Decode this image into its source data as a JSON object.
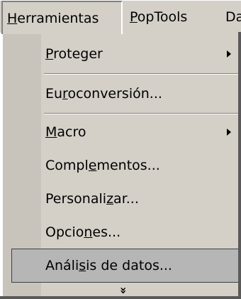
{
  "menubar": {
    "items": [
      {
        "pre": "",
        "key": "H",
        "post": "erramientas"
      },
      {
        "pre": "",
        "key": "P",
        "post": "opTools"
      },
      {
        "pre": "Da",
        "key": "",
        "post": ""
      }
    ]
  },
  "menu": {
    "items": [
      {
        "pre": "",
        "key": "P",
        "post": "roteger",
        "submenu": true
      },
      {
        "pre": "Eu",
        "key": "r",
        "post": "oconversión...",
        "submenu": false
      },
      {
        "pre": "",
        "key": "M",
        "post": "acro",
        "submenu": true
      },
      {
        "pre": "Compl",
        "key": "e",
        "post": "mentos...",
        "submenu": false
      },
      {
        "pre": "Personali",
        "key": "z",
        "post": "ar...",
        "submenu": false
      },
      {
        "pre": "Opcio",
        "key": "n",
        "post": "es...",
        "submenu": false
      },
      {
        "pre": "Análi",
        "key": "s",
        "post": "is de datos...",
        "submenu": false
      }
    ],
    "expand_glyph": "»"
  }
}
